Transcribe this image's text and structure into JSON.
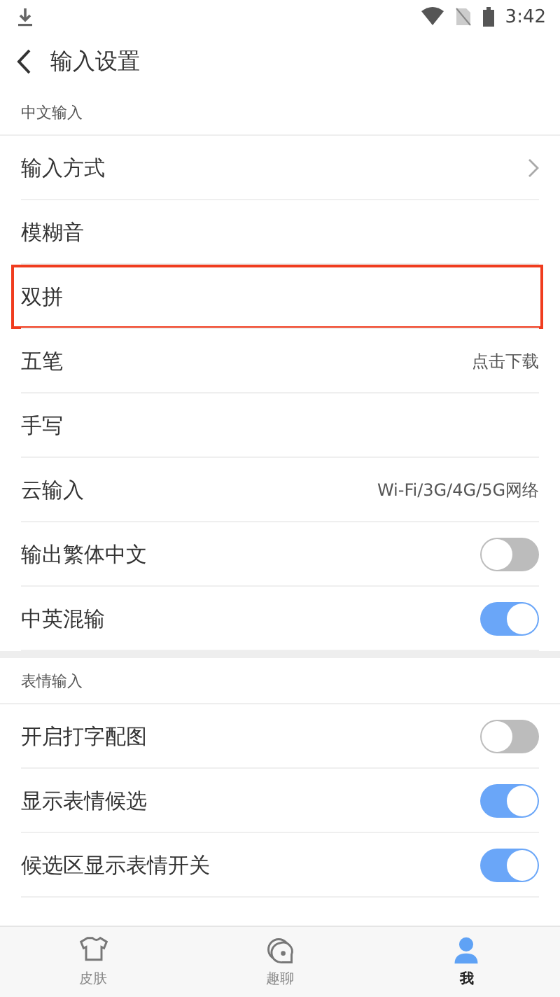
{
  "status_bar": {
    "time": "3:42"
  },
  "header": {
    "title": "输入设置"
  },
  "sections": [
    {
      "title": "中文输入",
      "rows": [
        {
          "kind": "arrow",
          "label": "输入方式",
          "highlighted": false
        },
        {
          "kind": "plain",
          "label": "模糊音",
          "highlighted": false
        },
        {
          "kind": "plain",
          "label": "双拼",
          "highlighted": true
        },
        {
          "kind": "value",
          "label": "五笔",
          "value": "点击下载",
          "highlighted": false
        },
        {
          "kind": "plain",
          "label": "手写",
          "highlighted": false
        },
        {
          "kind": "value",
          "label": "云输入",
          "value": "Wi-Fi/3G/4G/5G网络",
          "highlighted": false
        },
        {
          "kind": "toggle",
          "label": "输出繁体中文",
          "on": false,
          "highlighted": false
        },
        {
          "kind": "toggle",
          "label": "中英混输",
          "on": true,
          "highlighted": false
        }
      ]
    },
    {
      "title": "表情输入",
      "rows": [
        {
          "kind": "toggle",
          "label": "开启打字配图",
          "on": false,
          "highlighted": false
        },
        {
          "kind": "toggle",
          "label": "显示表情候选",
          "on": true,
          "highlighted": false
        },
        {
          "kind": "toggle",
          "label": "候选区显示表情开关",
          "on": true,
          "highlighted": false
        }
      ]
    }
  ],
  "bottom_nav": [
    {
      "kind": "shirt",
      "label": "皮肤",
      "selected": false
    },
    {
      "kind": "chat",
      "label": "趣聊",
      "selected": false
    },
    {
      "kind": "person",
      "label": "我",
      "selected": true
    }
  ]
}
